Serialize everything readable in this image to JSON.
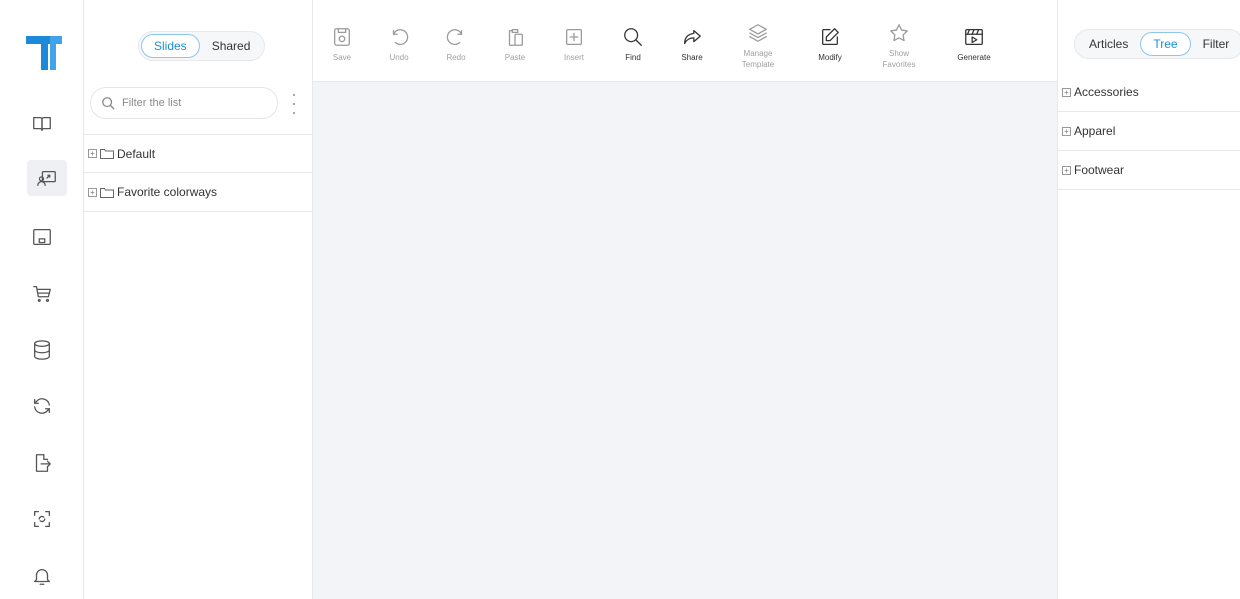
{
  "list_panel": {
    "tabs": [
      {
        "label": "Slides",
        "active": true
      },
      {
        "label": "Shared",
        "active": false
      }
    ],
    "search": {
      "placeholder": "Filter the list",
      "value": ""
    },
    "items": [
      {
        "label": "Default",
        "icon": "folder-icon"
      },
      {
        "label": "Favorite colorways",
        "icon": "folder-icon"
      }
    ]
  },
  "toolbar": {
    "buttons": [
      {
        "label": "Save",
        "icon": "save-icon",
        "enabled": false
      },
      {
        "label": "Undo",
        "icon": "undo-icon",
        "enabled": false
      },
      {
        "label": "Redo",
        "icon": "redo-icon",
        "enabled": false
      },
      {
        "label": "Paste",
        "icon": "paste-icon",
        "enabled": false
      },
      {
        "label": "Insert",
        "icon": "insert-icon",
        "enabled": false
      },
      {
        "label": "Find",
        "icon": "search-icon",
        "enabled": true
      },
      {
        "label": "Share",
        "icon": "share-icon",
        "enabled": true
      },
      {
        "label": "Manage Template",
        "icon": "layers-icon",
        "enabled": false
      },
      {
        "label": "Modify",
        "icon": "edit-icon",
        "enabled": true
      },
      {
        "label": "Show Favorites",
        "icon": "star-icon",
        "enabled": false
      },
      {
        "label": "Generate",
        "icon": "clapperboard-icon",
        "enabled": true
      }
    ]
  },
  "right_panel": {
    "tabs": [
      {
        "label": "Articles",
        "active": false
      },
      {
        "label": "Tree",
        "active": true
      },
      {
        "label": "Filter",
        "active": false
      }
    ],
    "items": [
      {
        "label": "Accessories"
      },
      {
        "label": "Apparel"
      },
      {
        "label": "Footwear"
      }
    ]
  },
  "rail": {
    "items": [
      {
        "icon": "book-icon"
      },
      {
        "icon": "presentation-icon",
        "active": true
      },
      {
        "icon": "board-icon"
      },
      {
        "icon": "cart-icon"
      },
      {
        "icon": "database-icon"
      },
      {
        "icon": "sync-icon"
      },
      {
        "icon": "export-icon"
      },
      {
        "icon": "scan-icon"
      },
      {
        "icon": "bell-icon"
      }
    ]
  },
  "colors": {
    "accent": "#1a8fd6",
    "logo": "#1e88d9",
    "canvas": "#f2f4f7"
  }
}
